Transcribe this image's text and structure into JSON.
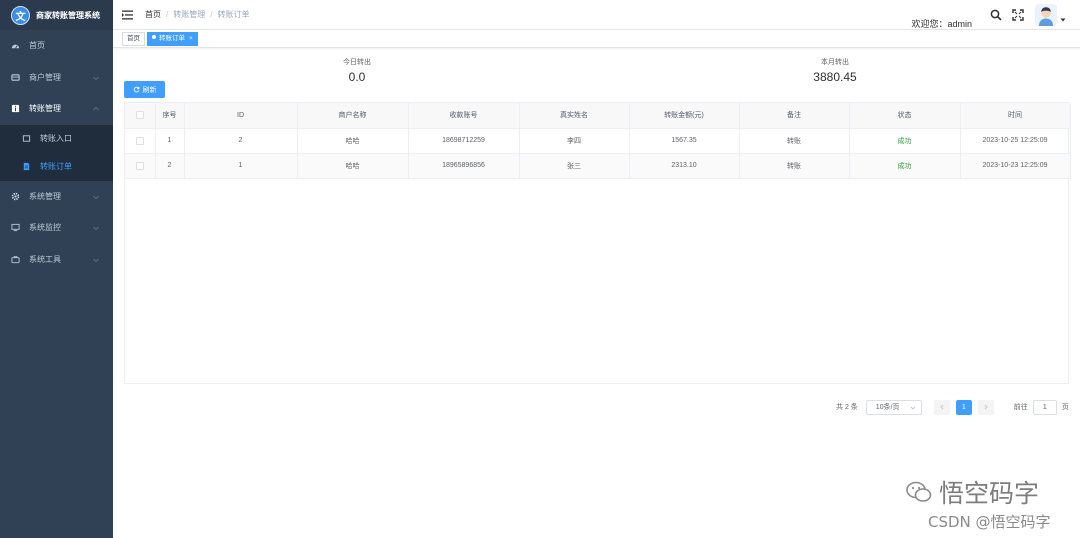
{
  "app": {
    "title": "商家转账管理系统",
    "logo_letter": "文"
  },
  "sidebar": {
    "items": [
      {
        "label": "首页",
        "icon": "dashboard-icon"
      },
      {
        "label": "商户管理",
        "icon": "shop-icon"
      },
      {
        "label": "转账管理",
        "icon": "info-icon"
      },
      {
        "label": "系统管理",
        "icon": "gear-icon"
      },
      {
        "label": "系统监控",
        "icon": "monitor-icon"
      },
      {
        "label": "系统工具",
        "icon": "toolbox-icon"
      }
    ],
    "sub_items": [
      {
        "label": "转账入口",
        "icon": "list-icon"
      },
      {
        "label": "转账订单",
        "icon": "document-icon",
        "active": true
      }
    ]
  },
  "header": {
    "breadcrumb": [
      "首页",
      "转账管理",
      "转账订单"
    ],
    "welcome": "欢迎您：admin"
  },
  "tags": {
    "home": "首页",
    "active": "转账订单",
    "close": "×"
  },
  "stats": {
    "today_label": "今日转出",
    "today_value": "0.0",
    "month_label": "本月转出",
    "month_value": "3880.45"
  },
  "toolbar": {
    "refresh_label": "刷新"
  },
  "table": {
    "columns": [
      "序号",
      "ID",
      "商户名称",
      "收款账号",
      "真实姓名",
      "转账金额(元)",
      "备注",
      "状态",
      "时间"
    ],
    "rows": [
      {
        "index": "1",
        "id": "2",
        "merchant": "哈哈",
        "account": "18698712259",
        "name": "李四",
        "amount": "1567.35",
        "remark": "转账",
        "status": "成功",
        "time": "2023-10-25 12:25:09"
      },
      {
        "index": "2",
        "id": "1",
        "merchant": "哈哈",
        "account": "18965896856",
        "name": "张三",
        "amount": "2313.10",
        "remark": "转账",
        "status": "成功",
        "time": "2023-10-23 12:25:09"
      }
    ]
  },
  "pagination": {
    "total": "共 2 条",
    "page_size": "10条/页",
    "current": "1",
    "goto_prefix": "前往",
    "goto_value": "1",
    "goto_suffix": "页"
  },
  "watermark": {
    "line1": "悟空码字",
    "line2": "CSDN @悟空码字"
  },
  "colors": {
    "sidebar_bg": "#304156",
    "accent": "#409eff",
    "success": "#2e9e3c"
  }
}
